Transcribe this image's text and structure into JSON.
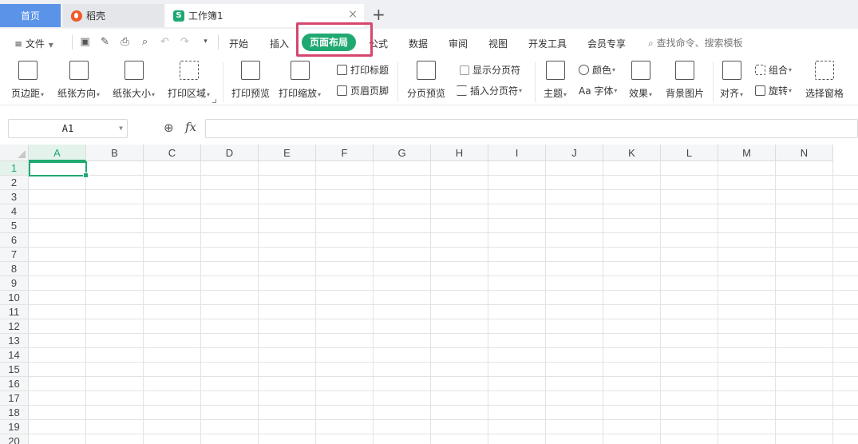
{
  "tabs": {
    "home": "首页",
    "daoke": "稻壳",
    "workbook": "工作簿1",
    "close_glyph": "×",
    "add_glyph": "+"
  },
  "menu": {
    "file": "≡ 文件",
    "items": [
      "开始",
      "插入",
      "页面布局",
      "公式",
      "数据",
      "审阅",
      "视图",
      "开发工具",
      "会员专享"
    ],
    "active": "页面布局",
    "search": "查找命令、搜索模板",
    "accent_color": "#1fa971",
    "highlight_color": "#d6466d"
  },
  "ribbon": {
    "margins": "页边距",
    "orientation": "纸张方向",
    "size": "纸张大小",
    "print_area": "打印区域",
    "print_preview": "打印预览",
    "print_scale": "打印缩放",
    "print_titles": "打印标题",
    "header_footer": "页眉页脚",
    "page_break_preview": "分页预览",
    "show_page_breaks": "显示分页符",
    "insert_page_break": "插入分页符",
    "theme": "主题",
    "colors": "颜色",
    "fonts": "Aa 字体",
    "effects": "效果",
    "background": "背景图片",
    "align": "对齐",
    "group": "组合",
    "rotate": "旋转",
    "selection_pane": "选择窗格"
  },
  "formula_bar": {
    "name_box": "A1",
    "fx": "fx",
    "formula": ""
  },
  "grid": {
    "columns": [
      "A",
      "B",
      "C",
      "D",
      "E",
      "F",
      "G",
      "H",
      "I",
      "J",
      "K",
      "L",
      "M",
      "N"
    ],
    "rows": [
      "1",
      "2",
      "3",
      "4",
      "5",
      "6",
      "7",
      "8",
      "9",
      "10",
      "11",
      "12",
      "13",
      "14",
      "15",
      "16",
      "17",
      "18",
      "19",
      "20"
    ],
    "selected_cell": "A1"
  }
}
